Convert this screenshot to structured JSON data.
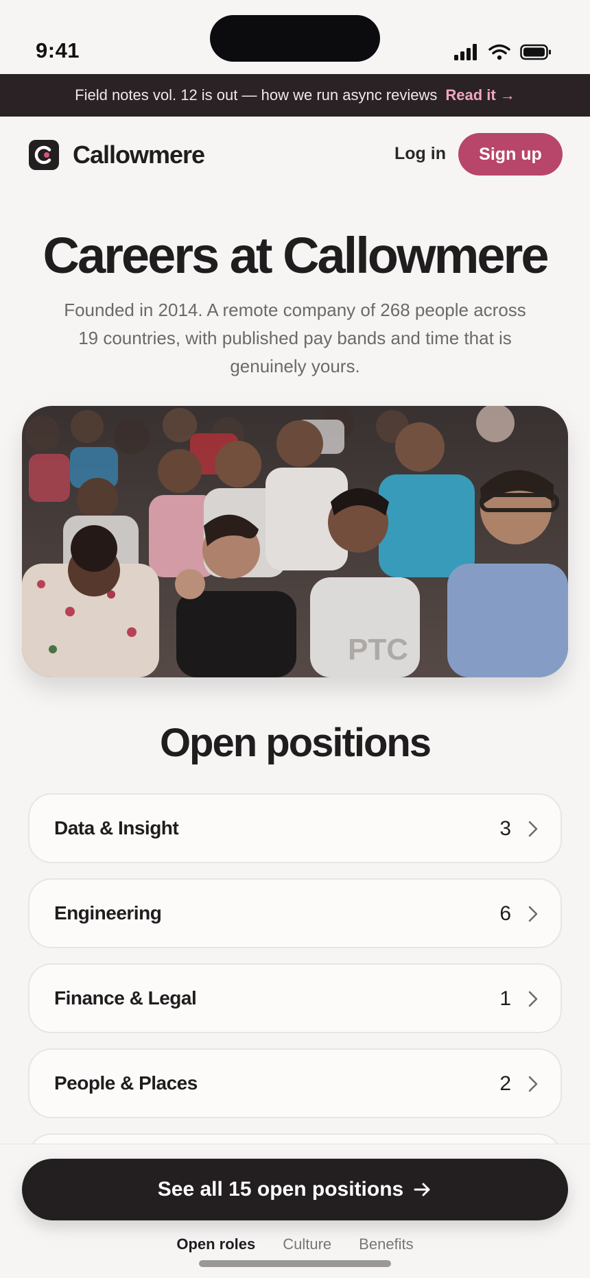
{
  "status_bar": {
    "time": "9:41"
  },
  "banner": {
    "text": "Field notes vol. 12 is out — how we run async reviews",
    "link": "Read it →",
    "link_color": "#f1a7bd"
  },
  "nav": {
    "brand": "Callowmere",
    "login": "Log in",
    "signup": "Sign up",
    "accent": "#b8466a"
  },
  "hero": {
    "title": "Careers at Callowmere",
    "subtitle": "Founded in 2014. A remote company of 268 people across 19 countries, with published pay bands and time that is genuinely yours."
  },
  "positions": {
    "title": "Open positions",
    "departments": [
      {
        "name": "Data & Insight",
        "count": "3"
      },
      {
        "name": "Engineering",
        "count": "6"
      },
      {
        "name": "Finance & Legal",
        "count": "1"
      },
      {
        "name": "People & Places",
        "count": "2"
      }
    ]
  },
  "cta": {
    "label": "See all 15 open positions",
    "icon": "arrow-right-icon"
  },
  "tabs": [
    "Open roles",
    "Culture",
    "Benefits"
  ]
}
